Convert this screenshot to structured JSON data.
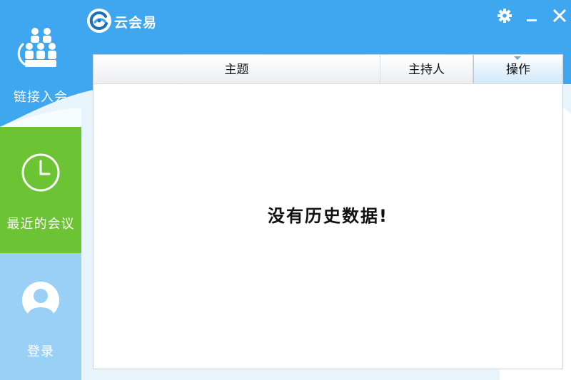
{
  "app": {
    "title": "云会易"
  },
  "window_controls": {
    "settings_icon": "gear-icon",
    "minimize_icon": "minimize-icon",
    "close_icon": "close-icon"
  },
  "sidebar": {
    "items": [
      {
        "label": "链接入会",
        "icon": "people-group-icon",
        "active": false
      },
      {
        "label": "最近的会议",
        "icon": "clock-icon",
        "active": true
      },
      {
        "label": "登录",
        "icon": "user-avatar-icon",
        "active": false
      }
    ]
  },
  "table": {
    "columns": [
      {
        "label": "主题"
      },
      {
        "label": "主持人"
      },
      {
        "label": "操作"
      }
    ],
    "rows": [],
    "empty_message": "没有历史数据!"
  },
  "colors": {
    "window_blue": "#3ea7ef",
    "active_green": "#6cc333",
    "login_light_blue": "#9bd0f6"
  }
}
